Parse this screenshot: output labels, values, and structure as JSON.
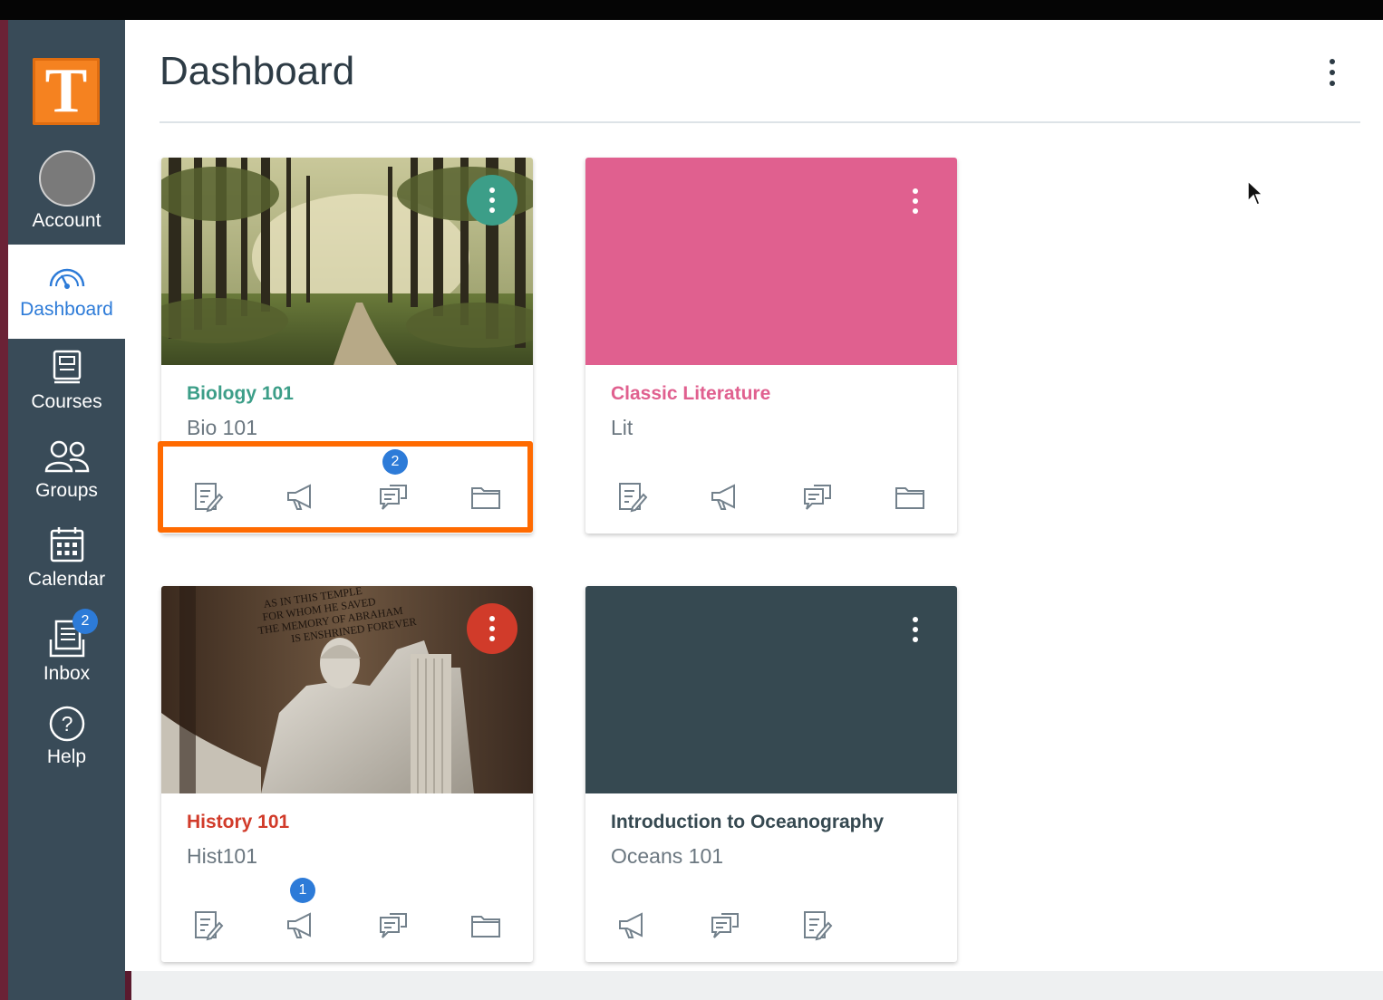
{
  "page": {
    "title": "Dashboard"
  },
  "nav": {
    "account": "Account",
    "dashboard": "Dashboard",
    "courses": "Courses",
    "groups": "Groups",
    "calendar": "Calendar",
    "inbox": "Inbox",
    "inbox_badge": "2",
    "help": "Help"
  },
  "logo": {
    "letter": "T"
  },
  "colors": {
    "sidebar": "#394b58",
    "active_link": "#2d7bd8",
    "biology": "#3c9e88",
    "literature": "#e0608f",
    "history": "#d13b2a",
    "oceanography": "#364951",
    "highlight": "#ff6a00"
  },
  "cards": [
    {
      "name": "Biology 101",
      "code": "Bio 101",
      "color": "#3c9e88",
      "hero": "forest-path-image",
      "actions": [
        {
          "icon": "assignments-icon",
          "badge": ""
        },
        {
          "icon": "announcements-icon",
          "badge": ""
        },
        {
          "icon": "discussions-icon",
          "badge": "2"
        },
        {
          "icon": "files-icon",
          "badge": ""
        }
      ]
    },
    {
      "name": "Classic Literature",
      "code": "Lit",
      "color": "#e0608f",
      "hero": "solid-color",
      "actions": [
        {
          "icon": "assignments-icon",
          "badge": ""
        },
        {
          "icon": "announcements-icon",
          "badge": ""
        },
        {
          "icon": "discussions-icon",
          "badge": ""
        },
        {
          "icon": "files-icon",
          "badge": ""
        }
      ]
    },
    {
      "name": "History 101",
      "code": "Hist101",
      "color": "#d13b2a",
      "hero": "lincoln-memorial-image",
      "hero_inscription": [
        "AS IN THIS TEMPLE",
        "FOR WHOM HE SAVED",
        "THE MEMORY OF ABRAHAM",
        "IS ENSHRINED FOREVER"
      ],
      "actions": [
        {
          "icon": "assignments-icon",
          "badge": ""
        },
        {
          "icon": "announcements-icon",
          "badge": "1"
        },
        {
          "icon": "discussions-icon",
          "badge": ""
        },
        {
          "icon": "files-icon",
          "badge": ""
        }
      ]
    },
    {
      "name": "Introduction to Oceanography",
      "code": "Oceans 101",
      "color": "#364951",
      "hero": "solid-color",
      "actions": [
        {
          "icon": "announcements-icon",
          "badge": ""
        },
        {
          "icon": "discussions-icon",
          "badge": ""
        },
        {
          "icon": "assignments-icon",
          "badge": ""
        }
      ]
    }
  ]
}
